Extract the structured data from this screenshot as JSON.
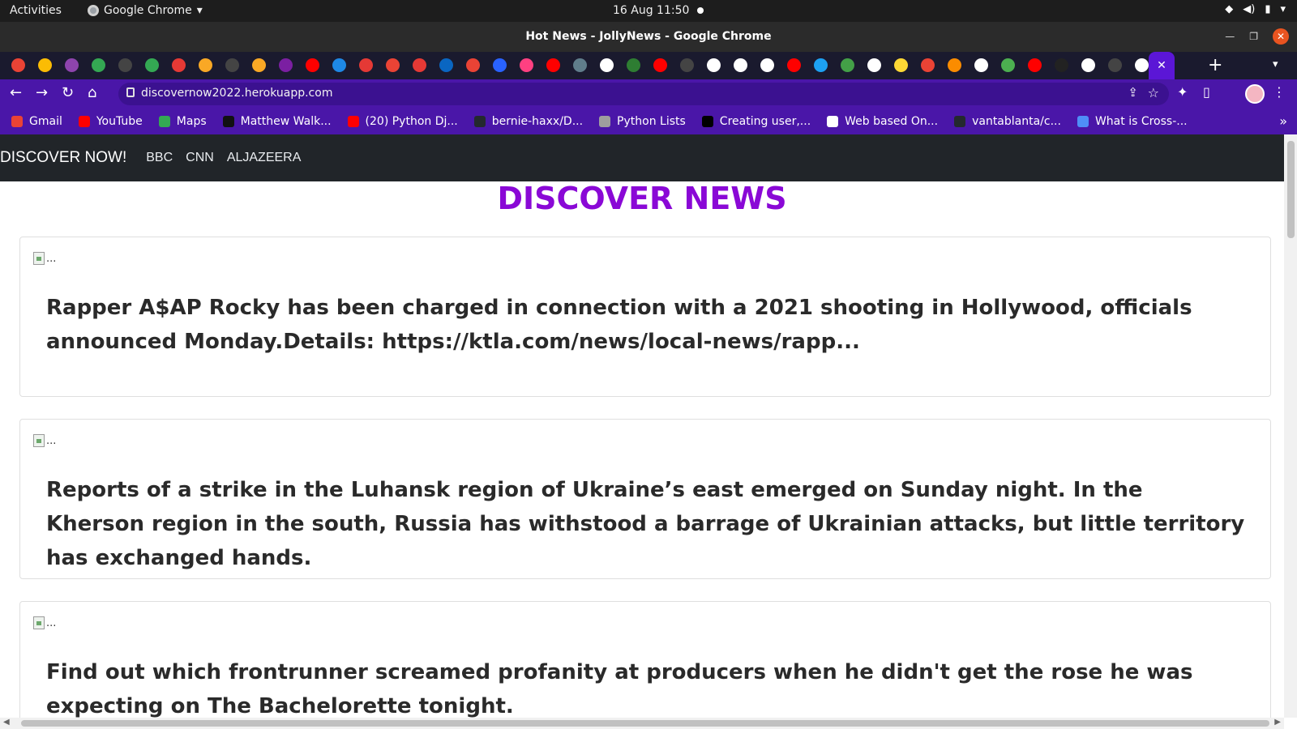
{
  "system_bar": {
    "activities": "Activities",
    "app_name": "Google Chrome",
    "datetime": "16 Aug  11:50"
  },
  "window": {
    "title": "Hot News - JollyNews - Google Chrome"
  },
  "tabs": {
    "icon_colors": [
      "#ea4335",
      "#fbbc04",
      "#8e44ad",
      "#34a853",
      "#444444",
      "#34a853",
      "#e53935",
      "#f9a825",
      "#444444",
      "#f9a825",
      "#7b1fa2",
      "#ff0000",
      "#1e88e5",
      "#e53935",
      "#ea4335",
      "#e53935",
      "#0a66c2",
      "#ea4335",
      "#2962ff",
      "#ff4081",
      "#ff0000",
      "#607d8b",
      "#ffffff",
      "#2e7d32",
      "#ff0000",
      "#444444",
      "#ffffff",
      "#ffffff",
      "#ffffff",
      "#ff0000",
      "#1da1f2",
      "#43a047",
      "#ffffff",
      "#fdd835",
      "#ea4335",
      "#fb8c00",
      "#ffffff",
      "#4caf50",
      "#ff0000",
      "#222222",
      "#ffffff",
      "#444444",
      "#ffffff"
    ],
    "active_close": "✕",
    "new_tab": "+"
  },
  "toolbar": {
    "url": "discovernow2022.herokuapp.com"
  },
  "bookmarks": [
    {
      "label": "Gmail",
      "color": "#ea4335"
    },
    {
      "label": "YouTube",
      "color": "#ff0000"
    },
    {
      "label": "Maps",
      "color": "#34a853"
    },
    {
      "label": "Matthew Walk...",
      "color": "#111111"
    },
    {
      "label": "(20) Python Dj...",
      "color": "#ff0000"
    },
    {
      "label": "bernie-haxx/D...",
      "color": "#24292e"
    },
    {
      "label": "Python Lists",
      "color": "#9e9e9e"
    },
    {
      "label": "Creating user,...",
      "color": "#000000"
    },
    {
      "label": "Web based On...",
      "color": "#ffffff"
    },
    {
      "label": "vantablanta/c...",
      "color": "#24292e"
    },
    {
      "label": "What is Cross-...",
      "color": "#4f8ef7"
    }
  ],
  "page": {
    "brand": "DISCOVER NOW!",
    "nav_links": [
      "BBC",
      "CNN",
      "ALJAZEERA"
    ],
    "heading": "DISCOVER NEWS",
    "image_alt": "...",
    "articles": [
      "Rapper A$AP Rocky has been charged in connection with a 2021 shooting in Hollywood, officials announced Monday.Details: https://ktla.com/news/local-news/rapp...",
      "Reports of a strike in the Luhansk region of Ukraine’s east emerged on Sunday night. In the Kherson region in the south, Russia has withstood a barrage of Ukrainian attacks, but little territory has exchanged hands.",
      "Find out which frontrunner screamed profanity at producers when he didn't get the rose he was expecting on The Bachelorette tonight."
    ]
  }
}
